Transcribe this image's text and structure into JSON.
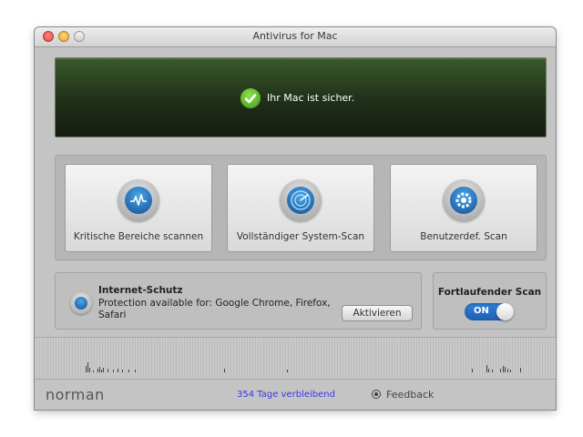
{
  "window": {
    "title": "Antivirus for Mac"
  },
  "status": {
    "message": "Ihr Mac ist sicher.",
    "icon": "checkmark-circle-icon"
  },
  "scans": [
    {
      "label": "Kritische Bereiche scannen",
      "icon": "waveform-scan-icon"
    },
    {
      "label": "Vollständiger System-Scan",
      "icon": "radar-scan-icon"
    },
    {
      "label": "Benutzerdef. Scan",
      "icon": "gear-scan-icon"
    }
  ],
  "internet_protection": {
    "title": "Internet-Schutz",
    "description": "Protection available for: Google Chrome, Firefox, Safari",
    "button_label": "Aktivieren",
    "icon": "shield-icon"
  },
  "continuous_scan": {
    "title": "Fortlaufender Scan",
    "toggle_label": "ON",
    "enabled": true
  },
  "footer": {
    "logo": "norman",
    "days_remaining": "354 Tage verbleibend",
    "feedback_label": "Feedback"
  },
  "colors": {
    "accent": "#2f82dc",
    "days_text": "#3a37e6",
    "status_bg": "#1f2f18",
    "check": "#5fbf2a"
  }
}
